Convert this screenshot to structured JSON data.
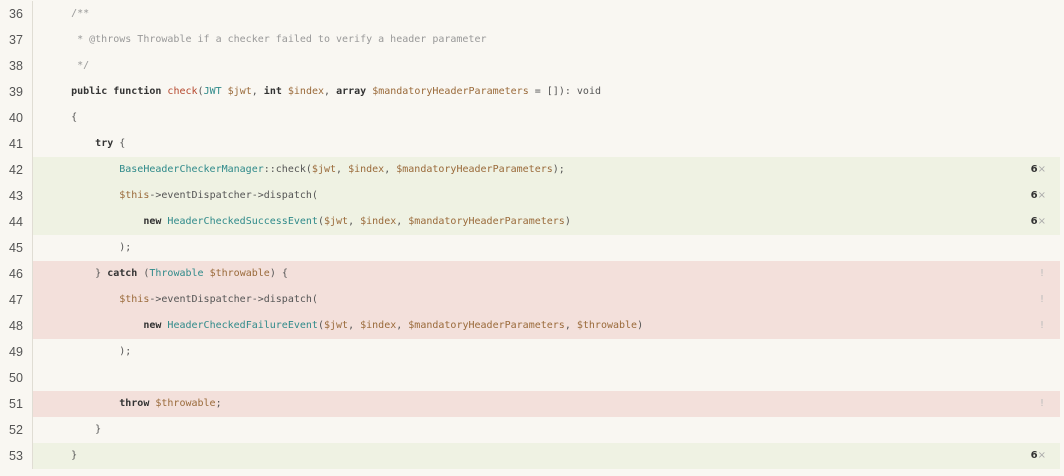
{
  "lines": [
    {
      "no": "36",
      "status": "none",
      "tokens": [
        [
          "c",
          "    /**"
        ]
      ]
    },
    {
      "no": "37",
      "status": "none",
      "tokens": [
        [
          "c",
          "     * @throws Throwable if a checker failed to verify a header parameter"
        ]
      ]
    },
    {
      "no": "38",
      "status": "none",
      "tokens": [
        [
          "c",
          "     */"
        ]
      ]
    },
    {
      "no": "39",
      "status": "none",
      "tokens": [
        [
          "",
          "    "
        ],
        [
          "k",
          "public function "
        ],
        [
          "f",
          "check"
        ],
        [
          "",
          "("
        ],
        [
          "t",
          "JWT "
        ],
        [
          "v",
          "$jwt"
        ],
        [
          "",
          ", "
        ],
        [
          "k",
          "int "
        ],
        [
          "v",
          "$index"
        ],
        [
          "",
          ", "
        ],
        [
          "k",
          "array "
        ],
        [
          "v",
          "$mandatoryHeaderParameters"
        ],
        [
          "",
          " = []): void"
        ]
      ]
    },
    {
      "no": "40",
      "status": "none",
      "tokens": [
        [
          "",
          "    {"
        ]
      ]
    },
    {
      "no": "41",
      "status": "none",
      "tokens": [
        [
          "",
          "        "
        ],
        [
          "k",
          "try"
        ],
        [
          "",
          " {"
        ]
      ]
    },
    {
      "no": "42",
      "status": "covered",
      "badge": "6",
      "tokens": [
        [
          "",
          "            "
        ],
        [
          "t",
          "BaseHeaderCheckerManager"
        ],
        [
          "",
          "::check("
        ],
        [
          "v",
          "$jwt"
        ],
        [
          "",
          ", "
        ],
        [
          "v",
          "$index"
        ],
        [
          "",
          ", "
        ],
        [
          "v",
          "$mandatoryHeaderParameters"
        ],
        [
          "",
          ");"
        ]
      ]
    },
    {
      "no": "43",
      "status": "covered",
      "badge": "6",
      "tokens": [
        [
          "",
          "            "
        ],
        [
          "v",
          "$this"
        ],
        [
          "",
          "->eventDispatcher->dispatch("
        ]
      ]
    },
    {
      "no": "44",
      "status": "covered",
      "badge": "6",
      "tokens": [
        [
          "",
          "                "
        ],
        [
          "k",
          "new "
        ],
        [
          "t",
          "HeaderCheckedSuccessEvent"
        ],
        [
          "",
          "("
        ],
        [
          "v",
          "$jwt"
        ],
        [
          "",
          ", "
        ],
        [
          "v",
          "$index"
        ],
        [
          "",
          ", "
        ],
        [
          "v",
          "$mandatoryHeaderParameters"
        ],
        [
          "",
          ")"
        ]
      ]
    },
    {
      "no": "45",
      "status": "none",
      "tokens": [
        [
          "",
          "            );"
        ]
      ]
    },
    {
      "no": "46",
      "status": "uncovered",
      "badge": "!",
      "tokens": [
        [
          "",
          "        } "
        ],
        [
          "k",
          "catch"
        ],
        [
          "",
          " ("
        ],
        [
          "t",
          "Throwable "
        ],
        [
          "v",
          "$throwable"
        ],
        [
          "",
          ") {"
        ]
      ]
    },
    {
      "no": "47",
      "status": "uncovered",
      "badge": "!",
      "tokens": [
        [
          "",
          "            "
        ],
        [
          "v",
          "$this"
        ],
        [
          "",
          "->eventDispatcher->dispatch("
        ]
      ]
    },
    {
      "no": "48",
      "status": "uncovered",
      "badge": "!",
      "tokens": [
        [
          "",
          "                "
        ],
        [
          "k",
          "new "
        ],
        [
          "t",
          "HeaderCheckedFailureEvent"
        ],
        [
          "",
          "("
        ],
        [
          "v",
          "$jwt"
        ],
        [
          "",
          ", "
        ],
        [
          "v",
          "$index"
        ],
        [
          "",
          ", "
        ],
        [
          "v",
          "$mandatoryHeaderParameters"
        ],
        [
          "",
          ", "
        ],
        [
          "v",
          "$throwable"
        ],
        [
          "",
          ")"
        ]
      ]
    },
    {
      "no": "49",
      "status": "none",
      "tokens": [
        [
          "",
          "            );"
        ]
      ]
    },
    {
      "no": "50",
      "status": "none",
      "tokens": [
        [
          "",
          ""
        ]
      ]
    },
    {
      "no": "51",
      "status": "uncovered",
      "badge": "!",
      "tokens": [
        [
          "",
          "            "
        ],
        [
          "k",
          "throw "
        ],
        [
          "v",
          "$throwable"
        ],
        [
          "",
          ";"
        ]
      ]
    },
    {
      "no": "52",
      "status": "none",
      "tokens": [
        [
          "",
          "        }"
        ]
      ]
    },
    {
      "no": "53",
      "status": "covered",
      "badge": "6",
      "tokens": [
        [
          "",
          "    }"
        ]
      ]
    }
  ],
  "hit_suffix": "×",
  "colors": {
    "covered": "#eff2e3",
    "uncovered": "#f3e0db",
    "background": "#f9f7f2"
  }
}
